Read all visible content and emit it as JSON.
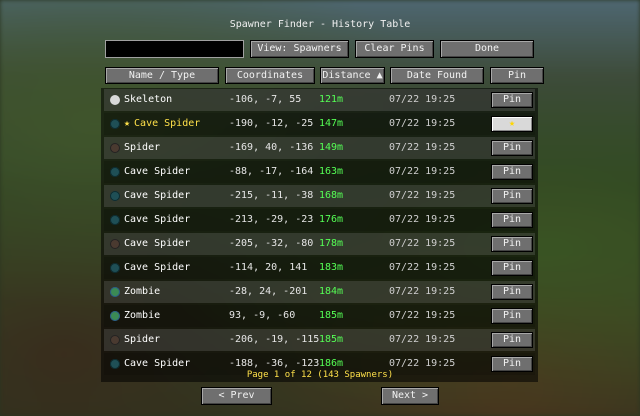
{
  "title": "Spawner Finder - History Table",
  "search": {
    "value": ""
  },
  "toolbar": {
    "view_label": "View: Spawners",
    "clear_label": "Clear Pins",
    "done_label": "Done"
  },
  "headers": {
    "name": "Name / Type",
    "coords": "Coordinates",
    "distance": "Distance ▲",
    "date": "Date Found",
    "pin": "Pin"
  },
  "rows": [
    {
      "icon": "skeleton-icon",
      "name": "Skeleton",
      "coords": "-106, -7, 55",
      "distance": "121m",
      "date": "07/22 19:25",
      "pin": "Pin",
      "pinned": false
    },
    {
      "icon": "cave-spider-icon",
      "name": "Cave Spider",
      "coords": "-190, -12, -25",
      "distance": "147m",
      "date": "07/22 19:25",
      "pin": "★",
      "pinned": true
    },
    {
      "icon": "spider-icon",
      "name": "Spider",
      "coords": "-169, 40, -136",
      "distance": "149m",
      "date": "07/22 19:25",
      "pin": "Pin",
      "pinned": false
    },
    {
      "icon": "cave-spider-icon",
      "name": "Cave Spider",
      "coords": "-88, -17, -164",
      "distance": "163m",
      "date": "07/22 19:25",
      "pin": "Pin",
      "pinned": false
    },
    {
      "icon": "cave-spider-icon",
      "name": "Cave Spider",
      "coords": "-215, -11, -38",
      "distance": "168m",
      "date": "07/22 19:25",
      "pin": "Pin",
      "pinned": false
    },
    {
      "icon": "cave-spider-icon",
      "name": "Cave Spider",
      "coords": "-213, -29, -23",
      "distance": "176m",
      "date": "07/22 19:25",
      "pin": "Pin",
      "pinned": false
    },
    {
      "icon": "spider-icon",
      "name": "Cave Spider",
      "coords": "-205, -32, -80",
      "distance": "178m",
      "date": "07/22 19:25",
      "pin": "Pin",
      "pinned": false
    },
    {
      "icon": "cave-spider-icon",
      "name": "Cave Spider",
      "coords": "-114, 20, 141",
      "distance": "183m",
      "date": "07/22 19:25",
      "pin": "Pin",
      "pinned": false
    },
    {
      "icon": "zombie-icon",
      "name": "Zombie",
      "coords": "-28, 24, -201",
      "distance": "184m",
      "date": "07/22 19:25",
      "pin": "Pin",
      "pinned": false
    },
    {
      "icon": "zombie-icon",
      "name": "Zombie",
      "coords": "93, -9, -60",
      "distance": "185m",
      "date": "07/22 19:25",
      "pin": "Pin",
      "pinned": false
    },
    {
      "icon": "spider-icon",
      "name": "Spider",
      "coords": "-206, -19, -115",
      "distance": "185m",
      "date": "07/22 19:25",
      "pin": "Pin",
      "pinned": false
    },
    {
      "icon": "cave-spider-icon",
      "name": "Cave Spider",
      "coords": "-188, -36, -123",
      "distance": "186m",
      "date": "07/22 19:25",
      "pin": "Pin",
      "pinned": false
    }
  ],
  "footer": "Page 1 of 12 (143 Spawners)",
  "nav": {
    "prev_label": "< Prev",
    "next_label": "Next >"
  },
  "colors": {
    "distance": "#55ff55",
    "footer": "#ffe14a",
    "star": "#ffe14a"
  }
}
